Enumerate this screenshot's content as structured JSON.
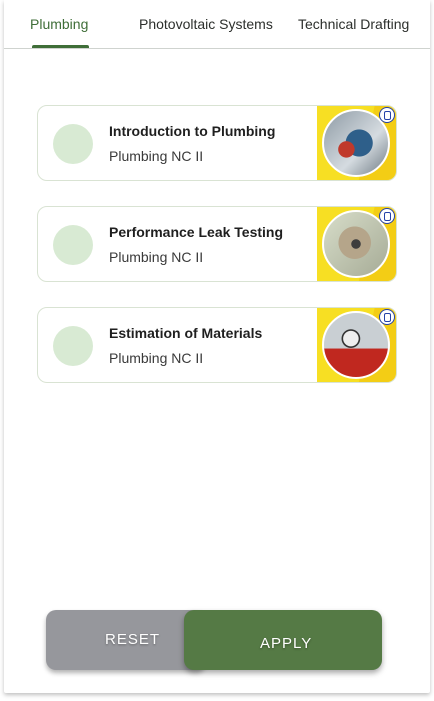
{
  "tabs": [
    {
      "label": "Plumbing",
      "active": true
    },
    {
      "label": "Photovoltaic Systems",
      "active": false
    },
    {
      "label": "Technical Drafting",
      "active": false
    }
  ],
  "courses": [
    {
      "title": "Introduction to Plumbing",
      "subtitle": "Plumbing NC II"
    },
    {
      "title": "Performance Leak Testing",
      "subtitle": "Plumbing NC II"
    },
    {
      "title": "Estimation of Materials",
      "subtitle": "Plumbing NC II"
    }
  ],
  "buttons": {
    "reset": "RESET",
    "apply": "APPLY"
  },
  "colors": {
    "accent": "#3f6e38",
    "apply": "#557a45",
    "reset": "#96979c",
    "selector": "#d8ead3",
    "thumb_bg": "#f7df23"
  },
  "icons": {
    "seal": "tesda-seal-icon"
  }
}
